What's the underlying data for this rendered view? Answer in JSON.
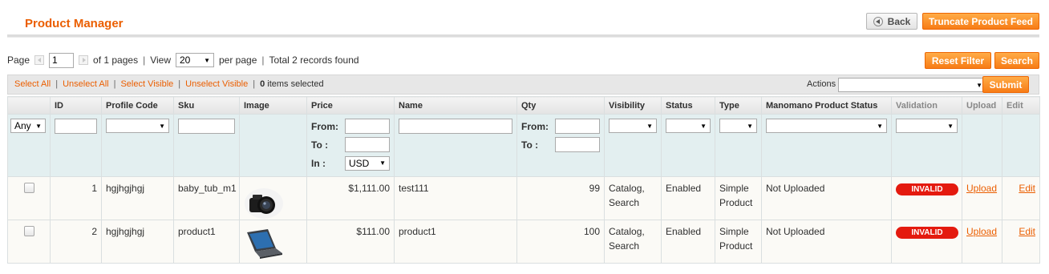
{
  "header": {
    "title": "Product Manager",
    "back_label": "Back",
    "truncate_label": "Truncate Product Feed"
  },
  "pager": {
    "page_label": "Page",
    "page_value": "1",
    "of_pages": "of 1 pages",
    "view_label": "View",
    "per_page_value": "20",
    "per_page_label": "per page",
    "separator": "|",
    "total": "Total 2 records found",
    "reset_label": "Reset Filter",
    "search_label": "Search"
  },
  "massaction": {
    "select_all": "Select All",
    "unselect_all": "Unselect All",
    "select_visible": "Select Visible",
    "unselect_visible": "Unselect Visible",
    "separator": "|",
    "selected_count": "0",
    "selected_suffix": "items selected",
    "actions_label": "Actions",
    "actions_value": "",
    "submit_label": "Submit"
  },
  "columns": {
    "id": "ID",
    "profile_code": "Profile Code",
    "sku": "Sku",
    "image": "Image",
    "price": "Price",
    "name": "Name",
    "qty": "Qty",
    "visibility": "Visibility",
    "status": "Status",
    "type": "Type",
    "manomano_status": "Manomano Product Status",
    "validation": "Validation",
    "upload": "Upload",
    "edit": "Edit"
  },
  "filters": {
    "massaction_value": "Any",
    "from_label": "From:",
    "to_label": "To :",
    "in_label": "In :",
    "currency": "USD"
  },
  "rows": [
    {
      "id": "1",
      "profile_code": "hgjhgjhgj",
      "sku": "baby_tub_m1",
      "image": "camera-image",
      "price": "$1,111.00",
      "name": "test111",
      "qty": "99",
      "visibility_1": "Catalog,",
      "visibility_2": "Search",
      "status": "Enabled",
      "type_1": "Simple",
      "type_2": "Product",
      "manomano_status": "Not Uploaded",
      "validation": "INVALID",
      "upload": "Upload",
      "edit": "Edit"
    },
    {
      "id": "2",
      "profile_code": "hgjhgjhgj",
      "sku": "product1",
      "image": "laptop-image",
      "price": "$111.00",
      "name": "product1",
      "qty": "100",
      "visibility_1": "Catalog,",
      "visibility_2": "Search",
      "status": "Enabled",
      "type_1": "Simple",
      "type_2": "Product",
      "manomano_status": "Not Uploaded",
      "validation": "INVALID",
      "upload": "Upload",
      "edit": "Edit"
    }
  ],
  "colors": {
    "accent": "#eb5e00",
    "button_orange": "#f77c16",
    "invalid_badge": "#e41a0f",
    "filter_row": "#e3eff0"
  }
}
